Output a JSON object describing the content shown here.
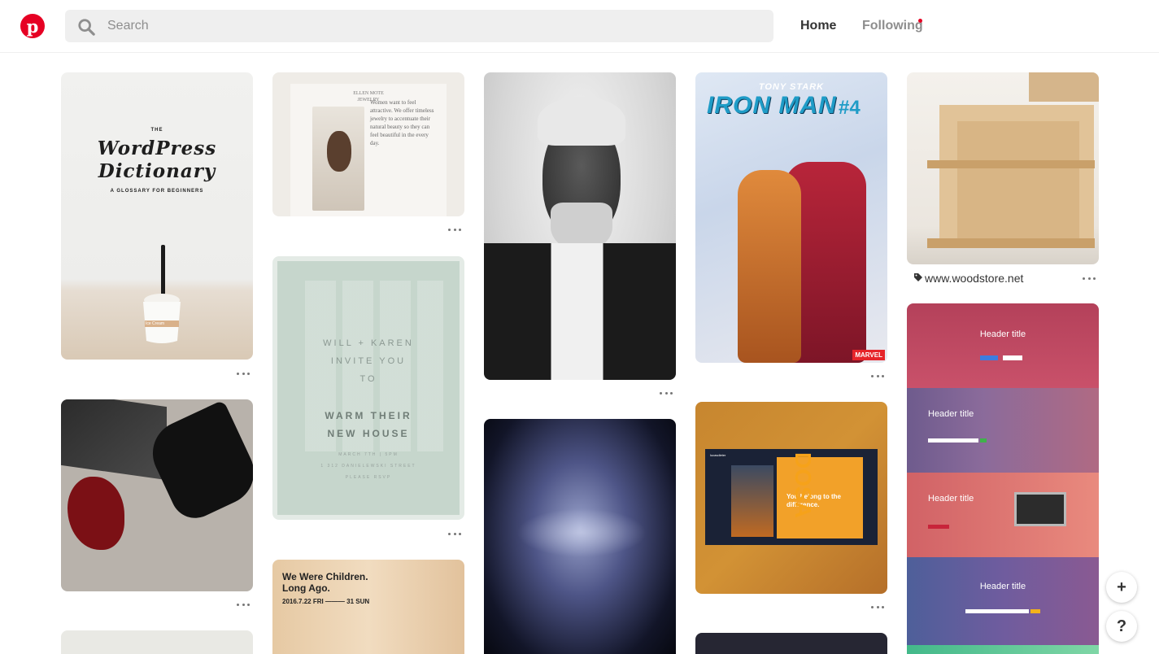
{
  "header": {
    "logo_letter": "p",
    "search_placeholder": "Search",
    "nav_home": "Home",
    "nav_following": "Following"
  },
  "colors": {
    "brand": "#e60023",
    "search_bg": "#efefef"
  },
  "pins": {
    "wordpress": {
      "the": "THE",
      "title_line1": "WordPress",
      "title_line2": "Dictionary",
      "subtitle": "A GLOSSARY FOR BEGINNERS",
      "cup_label": "Ice Cream"
    },
    "jewelry": {
      "brand_line1": "ELLEN MOTE",
      "brand_line2": "JEWELRY",
      "tagline": "Women want to feel attractive. We offer timeless jewelry to accentuate their natural beauty so they can feel beautiful in the every day."
    },
    "invite": {
      "line1": "WILL + KAREN",
      "line2": "INVITE YOU",
      "line3": "TO",
      "line4": "WARM THEIR",
      "line5": "NEW HOUSE",
      "line6": "MARCH 7TH | 5PM",
      "line7": "1 312 DANIELEWSKI STREET",
      "line8": "PLEASE RSVP"
    },
    "children": {
      "title_line1": "We Were Children.",
      "title_line2": "Long Ago.",
      "date": "2016.7.22 FRI ——— 31 SUN"
    },
    "ironman": {
      "name": "TONY STARK",
      "title": "IRON MAN",
      "issue": "#4",
      "publisher": "MARVEL"
    },
    "orange_site": {
      "brand": "lucasdieter",
      "headline_line1": "You belong to the",
      "headline_line2": "difference.",
      "vertical": "DOSA"
    },
    "woodstore": {
      "source_url": "www.woodstore.net"
    },
    "headers": {
      "title1": "Header title",
      "title2": "Header title",
      "title3": "Header title",
      "title4": "Header title"
    }
  },
  "floating": {
    "add_label": "+",
    "help_label": "?"
  }
}
